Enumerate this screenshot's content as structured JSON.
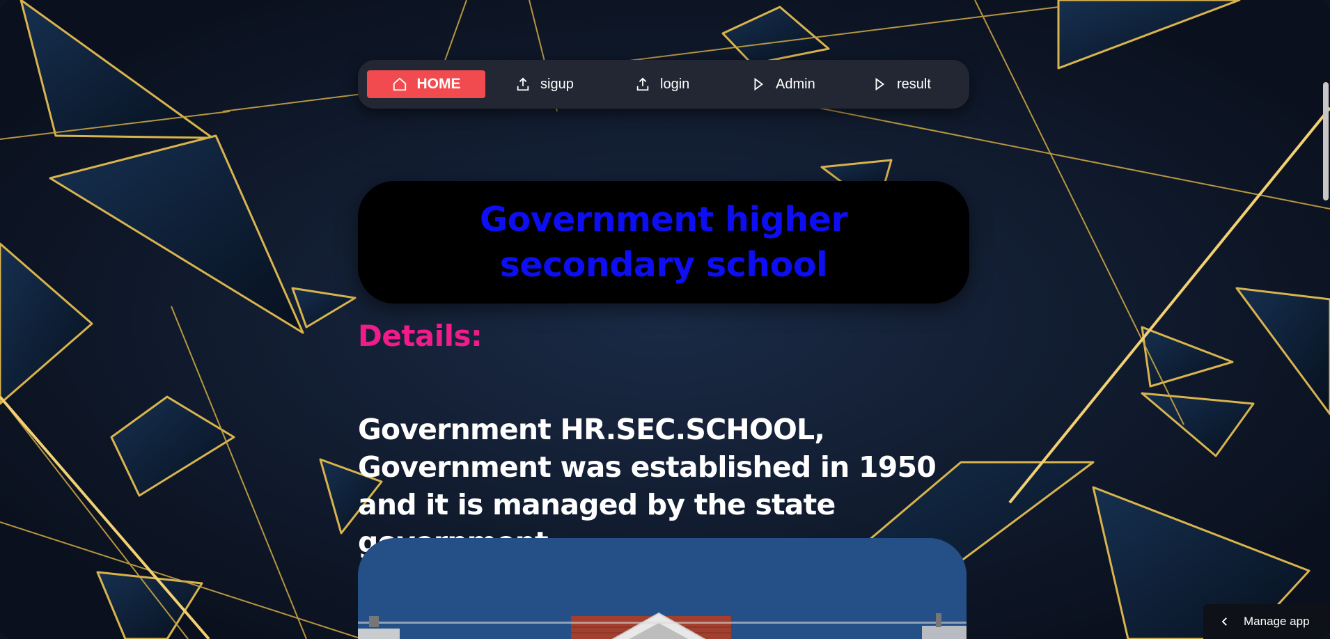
{
  "nav": {
    "items": [
      {
        "label": "HOME",
        "icon": "home-icon",
        "active": true
      },
      {
        "label": "sigup",
        "icon": "upload-icon"
      },
      {
        "label": "login",
        "icon": "upload-icon"
      },
      {
        "label": "Admin",
        "icon": "play-icon"
      },
      {
        "label": "result",
        "icon": "play-icon"
      }
    ]
  },
  "main": {
    "title": "Government higher secondary school",
    "details_label": "Details:",
    "description": "Government HR.SEC.SCHOOL, Government was established in 1950 and it is managed by the state government."
  },
  "footer": {
    "manage_app_label": "Manage app"
  },
  "colors": {
    "nav_active": "#f14b4f",
    "title_text": "#0d0ef2",
    "details_text": "#ef1c8a",
    "background": "#0c1322",
    "gold": "#e8c45a"
  }
}
